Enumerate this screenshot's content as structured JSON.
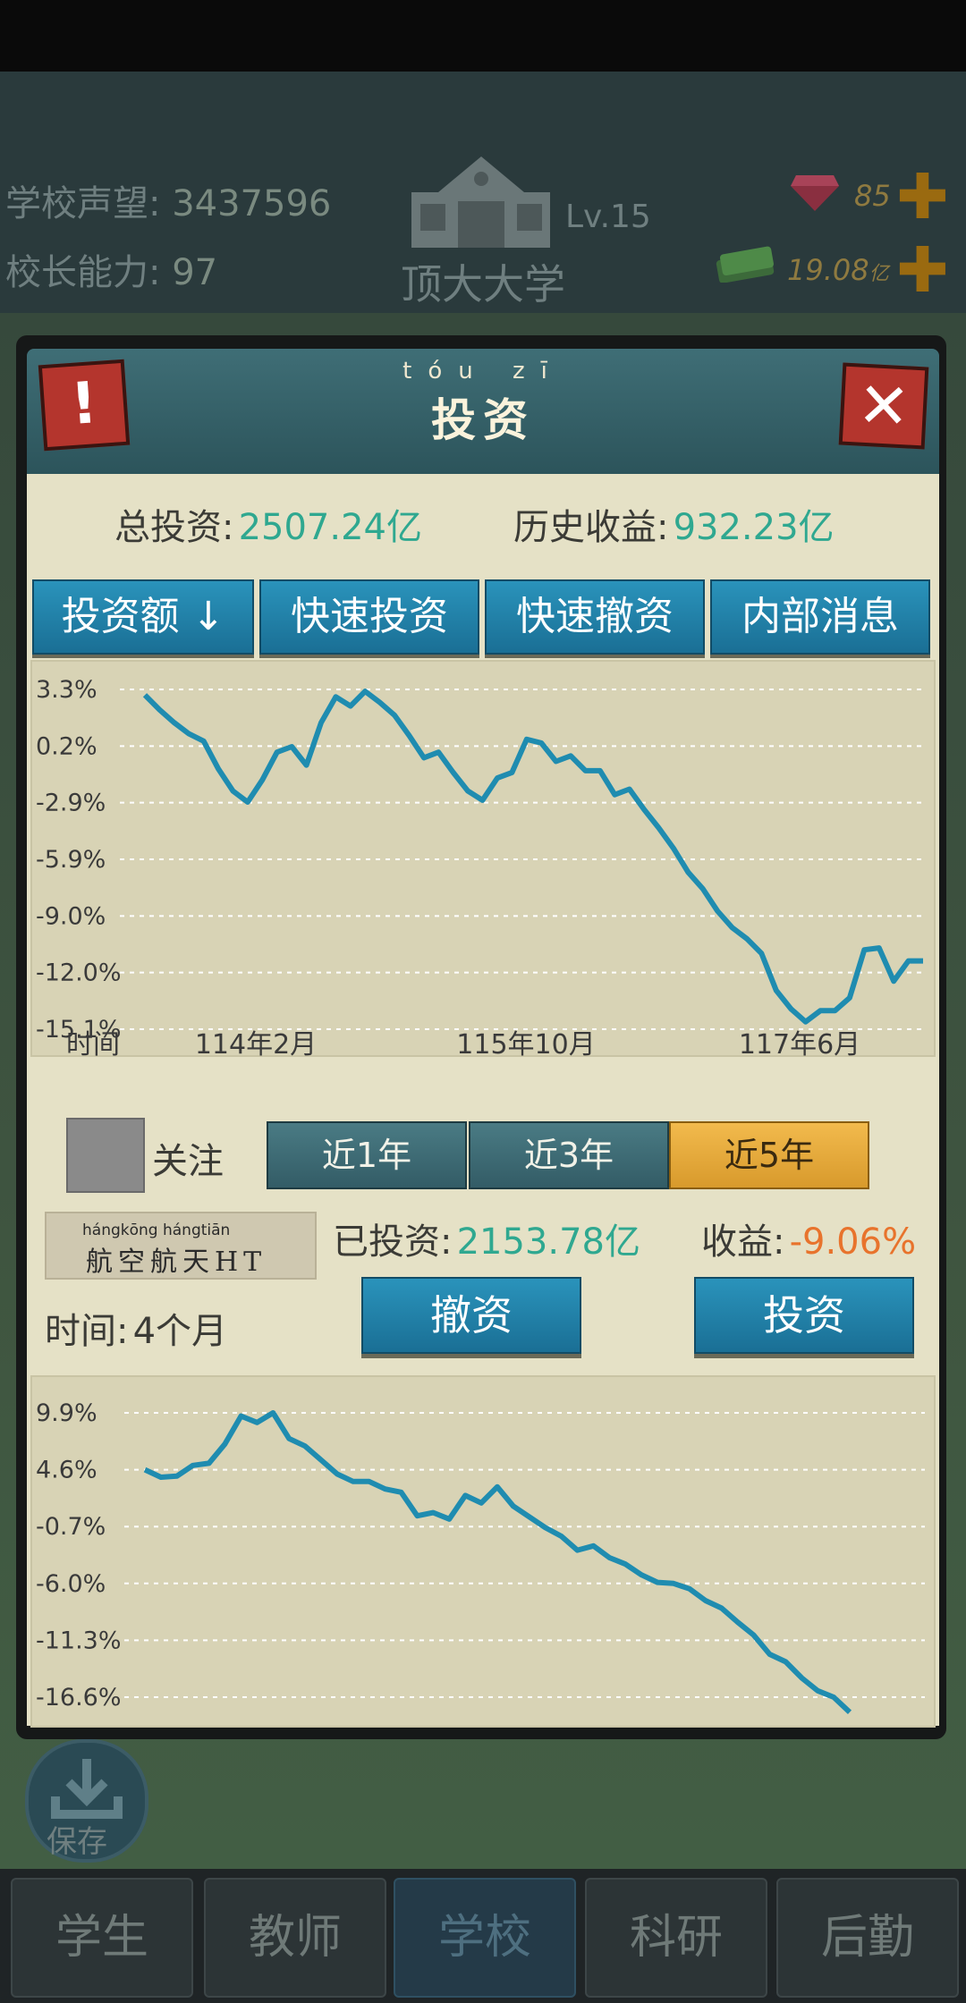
{
  "hud": {
    "reputation_label": "学校声望:",
    "reputation_value": "3437596",
    "ability_label": "校长能力:",
    "ability_value": "97",
    "level": "Lv.15",
    "school_name": "顶大大学",
    "gems": "85",
    "money": "19.08",
    "money_unit": "亿"
  },
  "modal": {
    "title_pinyin": "tóu zī",
    "title": "投资",
    "total_invest_label": "总投资:",
    "total_invest_value": "2507.24亿",
    "history_profit_label": "历史收益:",
    "history_profit_value": "932.23亿",
    "tabs": [
      "投资额 ↓",
      "快速投资",
      "快速撤资",
      "内部消息"
    ],
    "stock_name": "航空航天HT",
    "stock_pinyin": "hángkōng hángtiān",
    "follow_label": "关注",
    "periods": [
      "近1年",
      "近3年",
      "近5年"
    ],
    "active_period": "近5年",
    "invested_label": "已投资:",
    "invested_value": "2153.78亿",
    "profit_label": "收益:",
    "profit_value": "-9.06%",
    "time_label": "时间:",
    "time_value": "4个月",
    "x_label": "时间",
    "withdraw_label": "撤资",
    "invest_label": "投资"
  },
  "chart_data": [
    {
      "type": "line",
      "ytick_labels": [
        "3.3%",
        "0.2%",
        "-2.9%",
        "-5.9%",
        "-9.0%",
        "-12.0%",
        "-15.1%"
      ],
      "ylim": [
        -15.1,
        3.3
      ],
      "xtick_labels": [
        "114年2月",
        "115年10月",
        "117年6月"
      ],
      "color": "#1f8cb0",
      "values": [
        3.0,
        2.2,
        1.5,
        0.9,
        0.5,
        -1.0,
        -2.2,
        -2.8,
        -1.6,
        -0.1,
        0.2,
        -0.8,
        1.5,
        2.9,
        2.4,
        3.2,
        2.6,
        1.9,
        0.8,
        -0.4,
        -0.1,
        -1.2,
        -2.2,
        -2.7,
        -1.5,
        -1.2,
        0.6,
        0.4,
        -0.6,
        -0.3,
        -1.1,
        -1.1,
        -2.4,
        -2.1,
        -3.2,
        -4.2,
        -5.3,
        -6.6,
        -7.5,
        -8.7,
        -9.6,
        -10.2,
        -11.0,
        -13.0,
        -14.0,
        -14.7,
        -14.1,
        -14.1,
        -13.4,
        -10.8,
        -10.7,
        -12.5,
        -11.4,
        -11.4
      ]
    },
    {
      "type": "line",
      "ytick_labels": [
        "9.9%",
        "4.6%",
        "-0.7%",
        "-6.0%",
        "-11.3%",
        "-16.6%"
      ],
      "ylim": [
        -16.6,
        9.9
      ],
      "color": "#1f8cb0",
      "values": [
        4.6,
        3.9,
        4.0,
        5.0,
        5.2,
        7.0,
        9.6,
        9.0,
        9.9,
        7.5,
        6.8,
        5.5,
        4.2,
        3.5,
        3.5,
        2.8,
        2.5,
        0.3,
        0.6,
        0.0,
        2.2,
        1.5,
        3.0,
        1.2,
        0.2,
        -0.8,
        -1.6,
        -2.9,
        -2.5,
        -3.6,
        -4.2,
        -5.2,
        -5.9,
        -6.0,
        -6.5,
        -7.6,
        -8.3,
        -9.6,
        -10.8,
        -12.6,
        -13.3,
        -14.8,
        -16.0,
        -16.6,
        -18.0
      ]
    }
  ],
  "nav": {
    "save_label": "保存",
    "items": [
      "学生",
      "教师",
      "学校",
      "科研",
      "后勤"
    ],
    "active": "学校"
  }
}
